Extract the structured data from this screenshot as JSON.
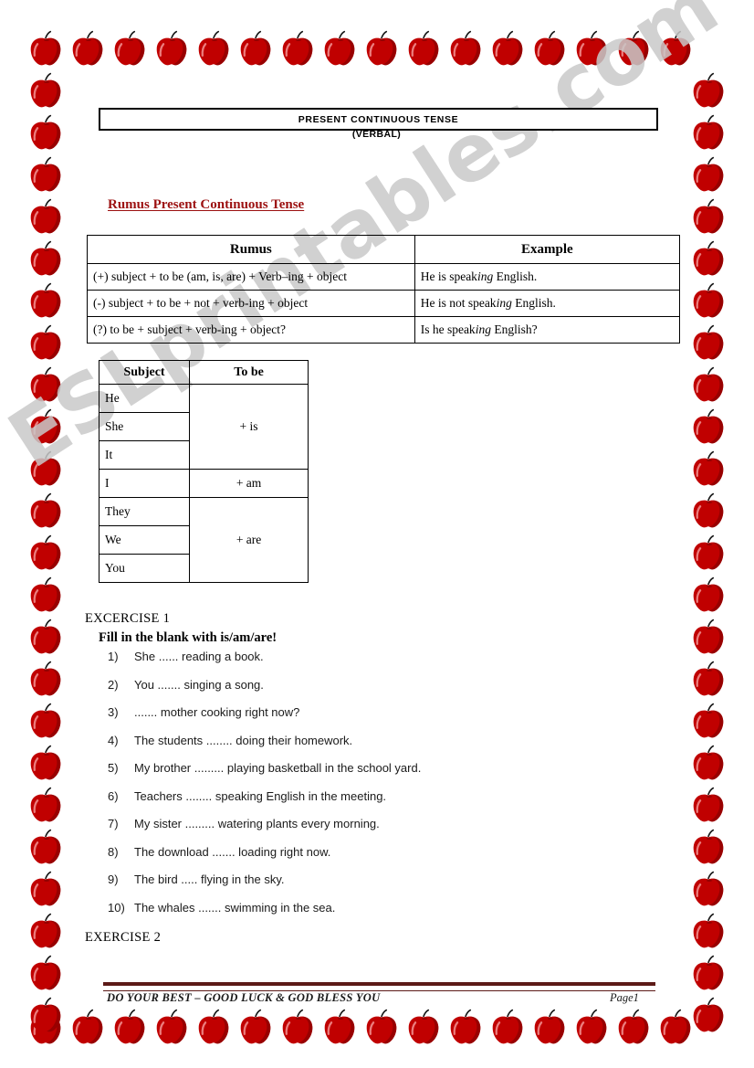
{
  "document": {
    "title": "PRESENT CONTINUOUS TENSE",
    "subtitle": "(VERBAL)",
    "section_heading": "Rumus Present Continuous Tense",
    "watermark": "ESLprintables.com"
  },
  "colors": {
    "heading_red": "#9c1111",
    "footer_rule": "#5c1a17",
    "apple_body": "#c00000",
    "apple_shadow": "#8b0000",
    "apple_highlight": "#f08a8a",
    "apple_stem": "#1a1a1a",
    "watermark_gray": "#c9c9c9",
    "border_black": "#000000"
  },
  "formula_table": {
    "headers": [
      "Rumus",
      "Example"
    ],
    "rows": [
      {
        "rumus": "(+) subject + to be (am, is, are) + Verb–ing + object",
        "example_pre": "He is speak",
        "example_italic": "ing",
        "example_post": " English."
      },
      {
        "rumus": "(-) subject + to be + not + verb-ing + object",
        "example_pre": "He is not speak",
        "example_italic": "ing",
        "example_post": " English."
      },
      {
        "rumus": "(?) to be + subject + verb-ing + object?",
        "example_pre": "Is he speak",
        "example_italic": "ing",
        "example_post": " English?"
      }
    ]
  },
  "subject_table": {
    "headers": [
      "Subject",
      "To be"
    ],
    "groups": [
      {
        "subjects": [
          "He",
          "She",
          "It"
        ],
        "to_be": "+ is"
      },
      {
        "subjects": [
          "I"
        ],
        "to_be": "+ am"
      },
      {
        "subjects": [
          "They",
          "We",
          "You"
        ],
        "to_be": "+ are"
      }
    ]
  },
  "exercise1": {
    "title": "EXCERCISE 1",
    "instruction": "Fill in the blank with is/am/are!",
    "items": [
      {
        "num": "1)",
        "text": "She ...... reading a book."
      },
      {
        "num": "2)",
        "text": "You ....... singing a song."
      },
      {
        "num": "3)",
        "text": "....... mother cooking right now?"
      },
      {
        "num": "4)",
        "text": "The students ........ doing their homework."
      },
      {
        "num": "5)",
        "text": "My brother ......... playing basketball in the school yard."
      },
      {
        "num": "6)",
        "text": "Teachers ........ speaking English in the meeting."
      },
      {
        "num": "7)",
        "text": "My sister ......... watering plants every morning."
      },
      {
        "num": "8)",
        "text": "The download ....... loading right now."
      },
      {
        "num": "9)",
        "text": "The bird ..... flying in the sky."
      },
      {
        "num": "10)",
        "text": "The whales ....... swimming in the sea."
      }
    ]
  },
  "exercise2": {
    "title": "EXERCISE 2"
  },
  "footer": {
    "left_text": "DO YOUR BEST – GOOD LUCK & GOD BLESS YOU",
    "page_label": "Page1"
  }
}
